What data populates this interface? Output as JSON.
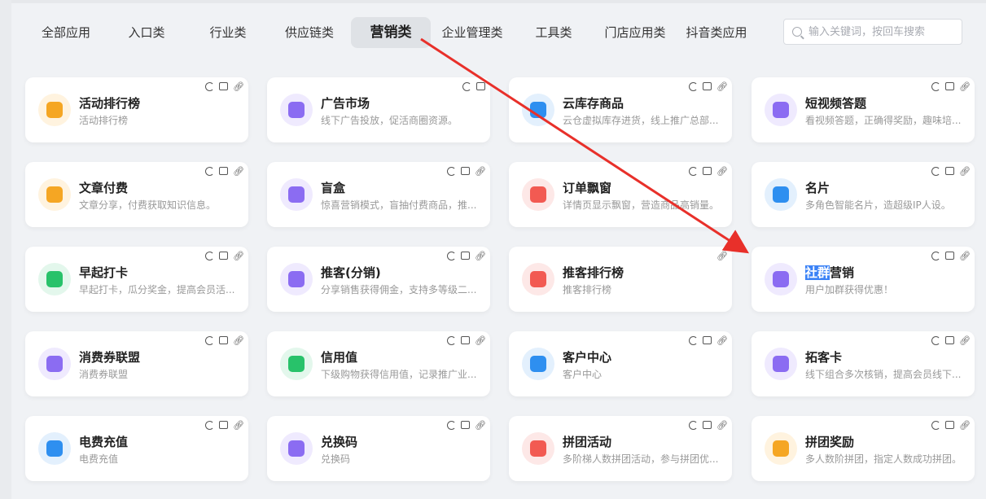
{
  "tabs": [
    {
      "label": "全部应用"
    },
    {
      "label": "入口类"
    },
    {
      "label": "行业类"
    },
    {
      "label": "供应链类"
    },
    {
      "label": "营销类"
    },
    {
      "label": "企业管理类"
    },
    {
      "label": "工具类"
    },
    {
      "label": "门店应用类"
    },
    {
      "label": "抖音类应用"
    }
  ],
  "active_tab": "营销类",
  "search": {
    "placeholder": "输入关键词，按回车搜索",
    "value": ""
  },
  "colors": {
    "accent_arrow": "#e8302a",
    "highlight": "#3b82f6",
    "active_tab_bg": "#dfe2e6"
  },
  "cards": [
    {
      "title": "活动排行榜",
      "desc": "活动排行榜",
      "icon": "bar-chart-icon",
      "color": "#f5a623",
      "bg": "#fff3df",
      "actions": [
        "sync-icon",
        "print-icon",
        "link-icon"
      ]
    },
    {
      "title": "广告市场",
      "desc": "线下广告投放，促活商圈资源。",
      "icon": "ad-board-icon",
      "color": "#8b6cf2",
      "bg": "#efeafe",
      "actions": [
        "sync-icon",
        "shop-icon"
      ]
    },
    {
      "title": "云库存商品",
      "desc": "云仓虚拟库存进货，线上推广总部...",
      "icon": "cloud-box-icon",
      "color": "#2e8ff0",
      "bg": "#e3f0fd",
      "actions": [
        "sync-icon",
        "print-icon",
        "link-icon"
      ]
    },
    {
      "title": "短视频答题",
      "desc": "看视频答题，正确得奖励，趣味培...",
      "icon": "video-icon",
      "color": "#8b6cf2",
      "bg": "#efeafe",
      "actions": [
        "sync-icon",
        "print-icon",
        "link-icon"
      ]
    },
    {
      "title": "文章付费",
      "desc": "文章分享，付费获取知识信息。",
      "icon": "paid-article-icon",
      "color": "#f5a623",
      "bg": "#fff3df",
      "actions": [
        "sync-icon",
        "print-icon",
        "link-icon"
      ]
    },
    {
      "title": "盲盒",
      "desc": "惊喜营销模式，盲抽付费商品，推...",
      "icon": "mystery-box-icon",
      "color": "#8b6cf2",
      "bg": "#efeafe",
      "actions": [
        "sync-icon",
        "print-icon",
        "link-icon"
      ]
    },
    {
      "title": "订单飘窗",
      "desc": "详情页显示飘窗，营造商品高销量。",
      "icon": "map-window-icon",
      "color": "#f25a52",
      "bg": "#fde8e7",
      "actions": [
        "sync-icon",
        "print-icon",
        "link-icon"
      ]
    },
    {
      "title": "名片",
      "desc": "多角色智能名片，造超级IP人设。",
      "icon": "id-card-icon",
      "color": "#2e8ff0",
      "bg": "#e3f0fd",
      "actions": [
        "sync-icon",
        "print-icon",
        "link-icon"
      ]
    },
    {
      "title": "早起打卡",
      "desc": "早起打卡，瓜分奖金，提高会员活...",
      "icon": "clock-icon",
      "color": "#28c26a",
      "bg": "#e3f7ec",
      "actions": [
        "sync-icon",
        "print-icon",
        "link-icon"
      ]
    },
    {
      "title": "推客(分销)",
      "desc": "分享销售获得佣金，支持多等级二...",
      "icon": "promoter-icon",
      "color": "#8b6cf2",
      "bg": "#efeafe",
      "actions": [
        "sync-icon",
        "print-icon",
        "link-icon"
      ]
    },
    {
      "title": "推客排行榜",
      "desc": "推客排行榜",
      "icon": "trophy-icon",
      "color": "#f25a52",
      "bg": "#fde8e7",
      "actions": [
        "link-icon"
      ]
    },
    {
      "title_hl": "社群",
      "title_rest": "营销",
      "desc": "用户加群获得优惠！",
      "icon": "community-icon",
      "color": "#8b6cf2",
      "bg": "#efeafe",
      "actions": [
        "sync-icon",
        "print-icon",
        "link-icon"
      ]
    },
    {
      "title": "消费券联盟",
      "desc": "消费券联盟",
      "icon": "coupon-icon",
      "color": "#8b6cf2",
      "bg": "#efeafe",
      "actions": [
        "sync-icon",
        "print-icon",
        "link-icon"
      ]
    },
    {
      "title": "信用值",
      "desc": "下级购物获得信用值，记录推广业...",
      "icon": "credit-icon",
      "color": "#28c26a",
      "bg": "#e3f7ec",
      "actions": [
        "sync-icon",
        "print-icon",
        "link-icon"
      ]
    },
    {
      "title": "客户中心",
      "desc": "客户中心",
      "icon": "customers-icon",
      "color": "#2e8ff0",
      "bg": "#e3f0fd",
      "actions": [
        "sync-icon",
        "print-icon",
        "link-icon"
      ]
    },
    {
      "title": "拓客卡",
      "desc": "线下组合多次核销，提高会员线下...",
      "icon": "grid-card-icon",
      "color": "#8b6cf2",
      "bg": "#efeafe",
      "actions": [
        "sync-icon",
        "print-icon",
        "link-icon"
      ]
    },
    {
      "title": "电费充值",
      "desc": "电费充值",
      "icon": "cube-icon",
      "color": "#2e8ff0",
      "bg": "#e3f0fd",
      "actions": [
        "sync-icon",
        "print-icon",
        "link-icon"
      ]
    },
    {
      "title": "兑换码",
      "desc": "兑换码",
      "icon": "redeem-code-icon",
      "color": "#8b6cf2",
      "bg": "#efeafe",
      "actions": [
        "sync-icon",
        "print-icon",
        "link-icon"
      ]
    },
    {
      "title": "拼团活动",
      "desc": "多阶梯人数拼团活动，参与拼团优...",
      "icon": "group-buy-icon",
      "color": "#f25a52",
      "bg": "#fde8e7",
      "actions": [
        "sync-icon",
        "print-icon",
        "link-icon"
      ]
    },
    {
      "title": "拼团奖励",
      "desc": "多人数阶拼团，指定人数成功拼团。",
      "icon": "reward-star-icon",
      "color": "#f5a623",
      "bg": "#fff3df",
      "actions": [
        "sync-icon",
        "print-icon",
        "link-icon"
      ]
    }
  ]
}
